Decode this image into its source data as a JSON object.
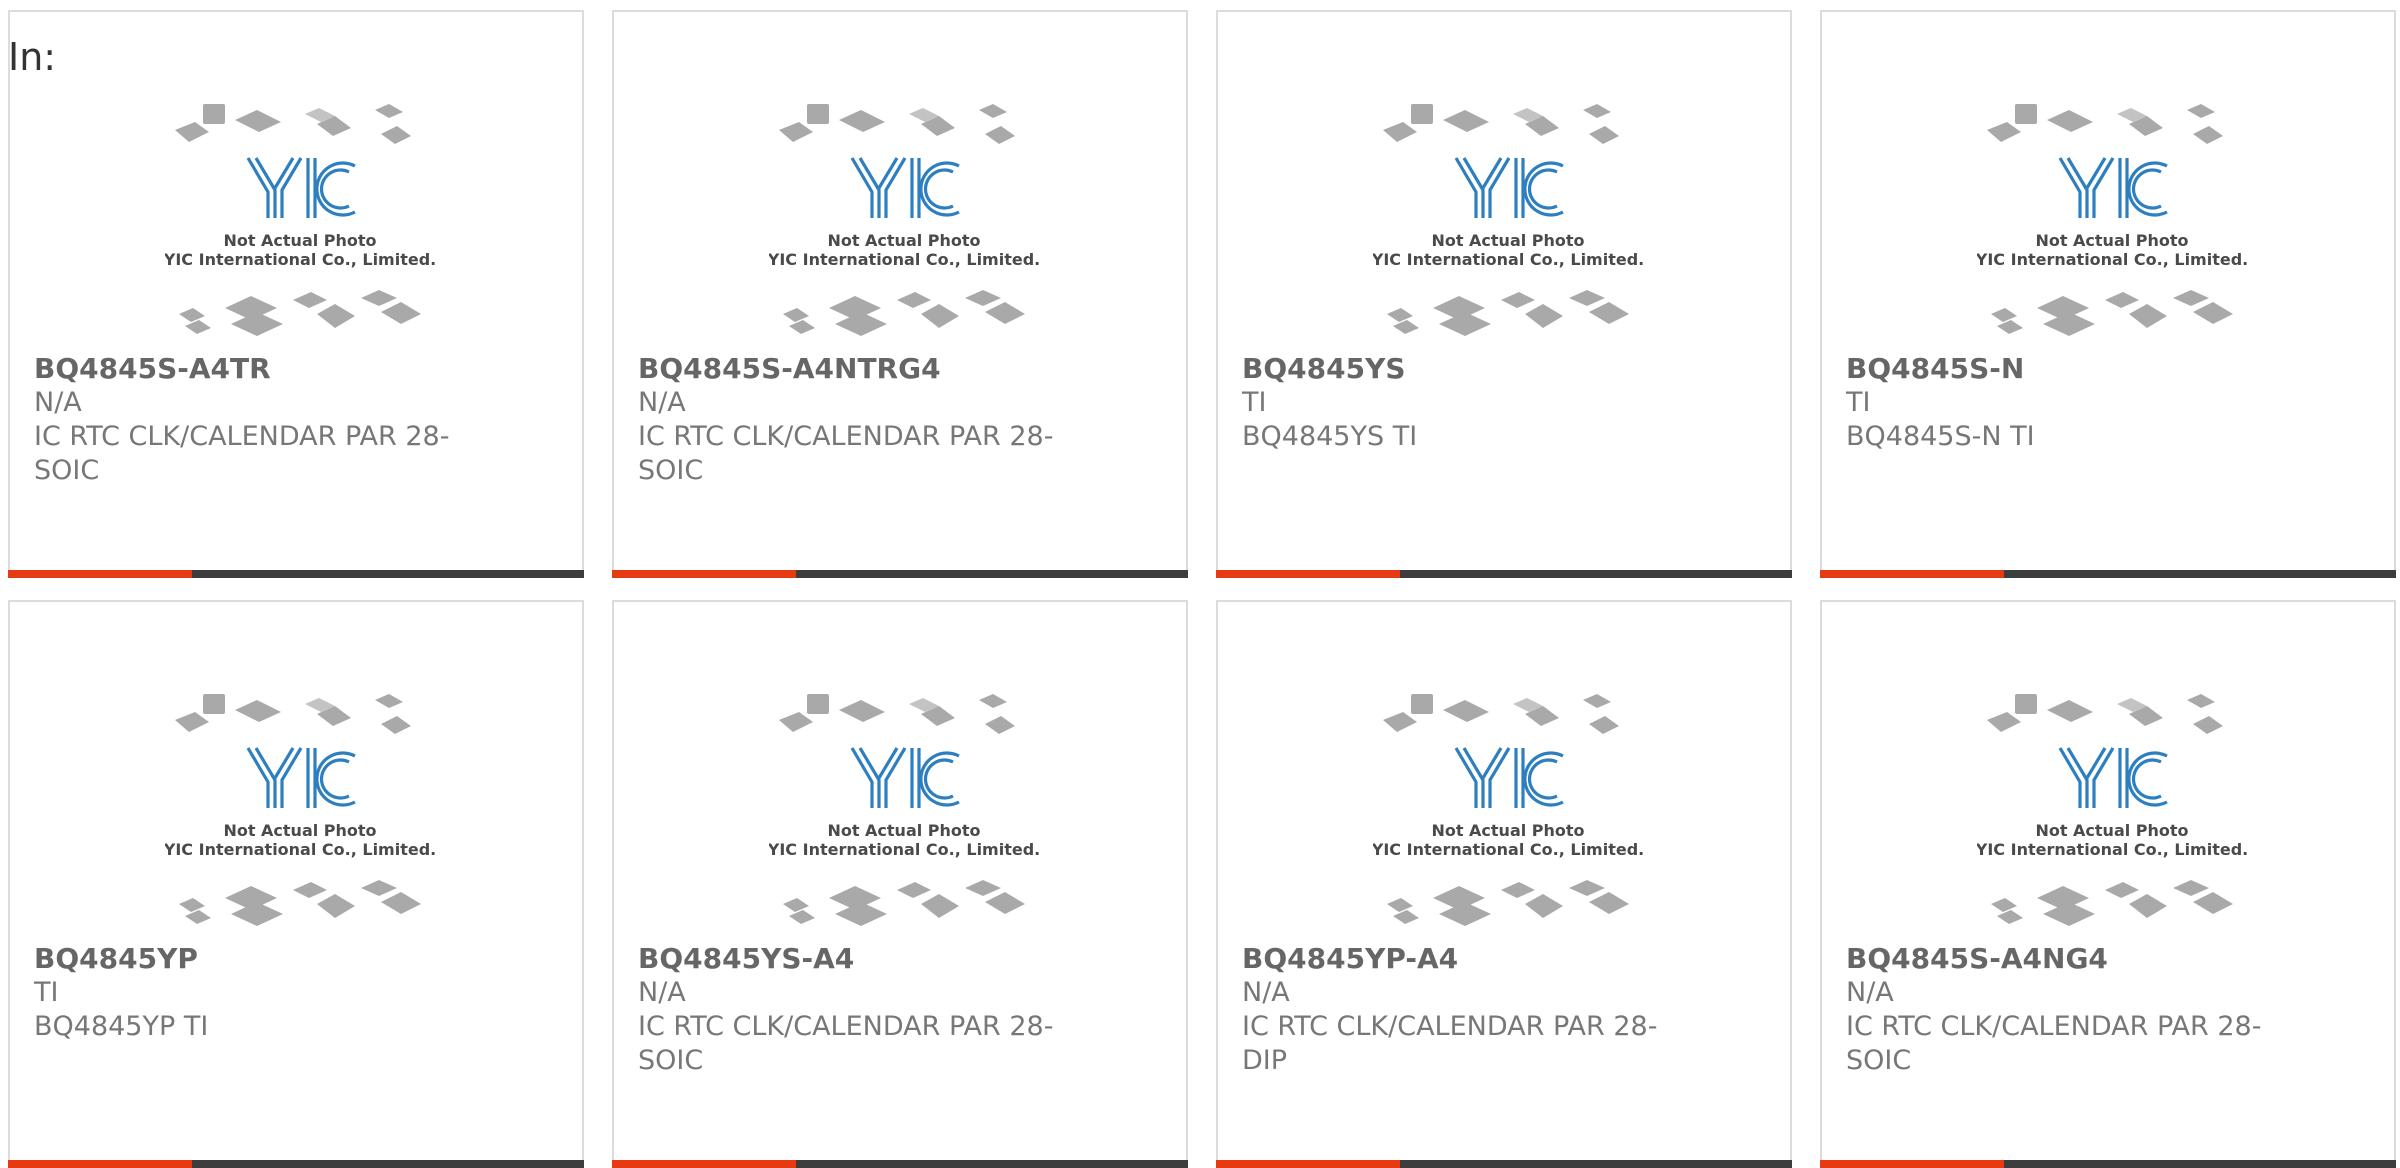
{
  "page": {
    "in_label": "In:"
  },
  "image_caption": {
    "line1": "Not Actual Photo",
    "line2": "YIC International Co., Limited.",
    "logo_text": "YIC"
  },
  "accent_color": "#e53a12",
  "bar_color": "#3d3d3d",
  "products": [
    {
      "part": "BQ4845S-A4TR",
      "manufacturer": "N/A",
      "desc_line1": "IC RTC CLK/CALENDAR PAR 28-",
      "desc_line2": "SOIC"
    },
    {
      "part": "BQ4845S-A4NTRG4",
      "manufacturer": "N/A",
      "desc_line1": "IC RTC CLK/CALENDAR PAR 28-",
      "desc_line2": "SOIC"
    },
    {
      "part": "BQ4845YS",
      "manufacturer": "TI",
      "desc_line1": "BQ4845YS TI",
      "desc_line2": ""
    },
    {
      "part": "BQ4845S-N",
      "manufacturer": "TI",
      "desc_line1": "BQ4845S-N TI",
      "desc_line2": ""
    },
    {
      "part": "BQ4845YP",
      "manufacturer": "TI",
      "desc_line1": "BQ4845YP TI",
      "desc_line2": ""
    },
    {
      "part": "BQ4845YS-A4",
      "manufacturer": "N/A",
      "desc_line1": "IC RTC CLK/CALENDAR PAR 28-",
      "desc_line2": "SOIC"
    },
    {
      "part": "BQ4845YP-A4",
      "manufacturer": "N/A",
      "desc_line1": "IC RTC CLK/CALENDAR PAR 28-",
      "desc_line2": "DIP"
    },
    {
      "part": "BQ4845S-A4NG4",
      "manufacturer": "N/A",
      "desc_line1": "IC RTC CLK/CALENDAR PAR 28-",
      "desc_line2": "SOIC"
    }
  ]
}
